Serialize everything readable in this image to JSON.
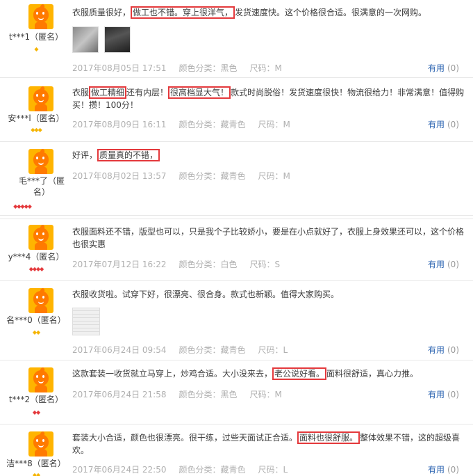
{
  "reviews": [
    {
      "user": "t***1（匿名）",
      "rank": "◆",
      "rank_color": "gold",
      "content_parts": [
        "衣服质量很好，",
        "做工也不错。穿上很洋气，",
        "发货速度快。这个价格很合适。很满意的一次网购。"
      ],
      "date": "2017年08月05日 17:51",
      "color": "颜色分类：黑色",
      "size": "尺码：M",
      "useful_label": "有用",
      "useful_count": "(0)",
      "photos": [
        "photo-thumb",
        "photo-thumb"
      ]
    },
    {
      "user": "安***l（匿名）",
      "rank": "◆◆◆",
      "rank_color": "gold",
      "content_parts": [
        "衣服",
        "做工精细",
        "还有内层！",
        "很高档显大气！",
        "款式时尚脱俗！发货速度很快！物流很给力！非常满意！值得购买！攒！100分！"
      ],
      "date": "2017年08月09日 16:11",
      "color": "颜色分类：藏青色",
      "size": "尺码：M",
      "useful_label": "有用",
      "useful_count": "(0)"
    },
    {
      "user": "毛***了（匿名）",
      "rank": "◆◆◆◆◆",
      "rank_color": "red",
      "content_parts": [
        "好评，",
        "质量真的不错，"
      ],
      "date": "2017年08月02日 13:57",
      "color": "颜色分类：藏青色",
      "size": "尺码：M"
    },
    {
      "user": "y***4（匿名）",
      "rank": "◆◆◆◆",
      "rank_color": "red",
      "content": "衣服面料还不错，版型也可以，只是我个子比较娇小，要是在小点就好了，衣服上身效果还可以，这个价格也很实惠",
      "date": "2017年07月12日 16:22",
      "color": "颜色分类：白色",
      "size": "尺码：S",
      "useful_label": "有用",
      "useful_count": "(0)"
    },
    {
      "user": "名***0（匿名）",
      "rank": "◆◆",
      "rank_color": "gold",
      "content": "衣服收货啦。试穿下好，很漂亮、很合身。款式也新颖。值得大家购买。",
      "date": "2017年06月24日 09:54",
      "color": "颜色分类：藏青色",
      "size": "尺码：L",
      "useful_label": "有用",
      "useful_count": "(0)",
      "photos": [
        "photo-thumb"
      ]
    },
    {
      "user": "t***2（匿名）",
      "rank": "◆◆",
      "rank_color": "red",
      "content_parts": [
        "这款套装一收货就立马穿上，炒鸡合适。大小没来去，",
        "老公说好看。",
        "面料很舒适，真心力推。"
      ],
      "date": "2017年06月24日 21:58",
      "color": "颜色分类：黑色",
      "size": "尺码：M",
      "useful_label": "有用",
      "useful_count": "(0)"
    },
    {
      "user": "洁***8（匿名）",
      "rank": "◆◆",
      "rank_color": "gold",
      "content_parts": [
        "套装大小合适，颜色也很漂亮。很干练，过些天面试正合适。",
        "面料也很舒服。",
        "整体效果不错，这的超级喜欢。"
      ],
      "date": "2017年06月24日 22:50",
      "color": "颜色分类：藏青色",
      "size": "尺码：L",
      "useful_label": "有用",
      "useful_count": "(0)"
    }
  ]
}
